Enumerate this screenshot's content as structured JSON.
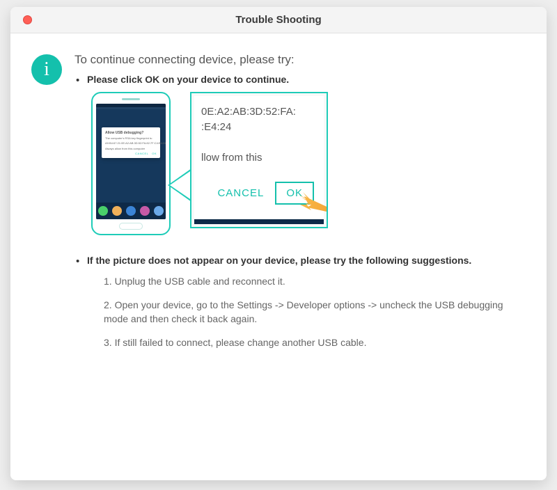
{
  "window": {
    "title": "Trouble Shooting"
  },
  "heading": "To continue connecting device, please try:",
  "bullet1": "Please click OK on your device to continue.",
  "bullet2": "If the picture does not appear on your device, please try the following suggestions.",
  "steps": {
    "s1": "1. Unplug the USB cable and reconnect it.",
    "s2": "2. Open your device, go to the Settings -> Developer options -> uncheck the USB debugging mode and then check it back again.",
    "s3": "3. If still failed to connect, please change another USB cable."
  },
  "dialog_mini": {
    "title": "Allow USB debugging?",
    "body1": "The computer's RSA key fingerprint is:",
    "body2": "A9:B4:67:21:0E:A2:AB:3D:52:FA:82:7F:C4:E4:24",
    "always": "Always allow from this computer",
    "cancel": "CANCEL",
    "ok": "OK"
  },
  "zoom": {
    "line1": "0E:A2:AB:3D:52:FA:",
    "line2": ":E4:24",
    "line3": "llow from this",
    "cancel": "CANCEL",
    "ok": "OK"
  },
  "colors": {
    "accent": "#14c0ac",
    "arrow": "#f7a93b"
  }
}
